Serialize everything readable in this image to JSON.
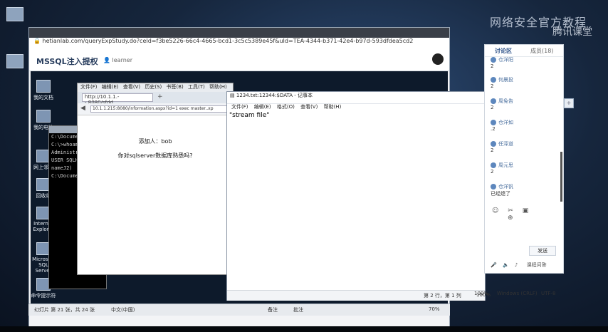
{
  "watermark": "网络安全官方教程",
  "watermark2": "腾讯课堂",
  "outer_side_icons": [
    "",
    "",
    ""
  ],
  "browser": {
    "url": "hetianlab.com/queryExpStudy.do?ceId=f3be5226-66c4-4665-bcd1-3c5c5389e45f&uId=TEA-4344-b371-42e4-b97d-593dfdea5cd2",
    "lab_title": "MSSQL注入提权",
    "learner": "learner"
  },
  "remote_desktop": {
    "icons": [
      "我的文档",
      "我的电脑",
      "网上邻居",
      "回收站",
      "Internet Explorer",
      "Microsoft SQL Server",
      "命令提示符"
    ],
    "cmd_lines": [
      "C:\\Documents",
      "",
      "C:\\>whoami",
      "",
      "Administrat",
      "USER SQLH",
      "nameJ2)",
      "",
      "C:\\Documents"
    ],
    "taskbar_left": "幻灯片 第 21 张，共 24 张",
    "taskbar_lang": "中文(中国)",
    "taskbar_notes": "备注",
    "taskbar_comments": "批注",
    "zoom": "70%"
  },
  "ie": {
    "menu": [
      "文件(F)",
      "编辑(E)",
      "查看(V)",
      "历史(S)",
      "书签(B)",
      "工具(T)",
      "帮助(H)"
    ],
    "tab_label": "http://10.1.1.--.8080/sfdd...",
    "url": "10.1.1.215:8080/information.aspx?id=1 exec master..xp",
    "added_text": "添加人：bob",
    "question_text": "你对sqlserver数据库熟悉吗?"
  },
  "notepad": {
    "title": "1234.txt:12344:$DATA - 记事本",
    "menu": [
      "文件(F)",
      "编辑(E)",
      "格式(O)",
      "查看(V)",
      "帮助(H)"
    ],
    "content": "\"stream file\"",
    "status_pos": "第 2 行，第 1 列",
    "status_zoom": "100%",
    "status_eol": "Windows (CRLF)",
    "status_enc": "UTF-8"
  },
  "discussion": {
    "tab_discuss": "讨论区",
    "tab_members": "成员(18)",
    "messages": [
      {
        "name": "仓洋阳",
        "text": "2"
      },
      {
        "name": "何晨投",
        "text": "2"
      },
      {
        "name": "周免告",
        "text": "2"
      },
      {
        "name": "仓洋如",
        "text": ".2"
      },
      {
        "name": "任泽道",
        "text": "2"
      },
      {
        "name": "周元思",
        "text": "2"
      },
      {
        "name": "仓洋钒",
        "text": "已经熄了"
      }
    ],
    "send_label": "发送",
    "open_label": "课程问答"
  }
}
